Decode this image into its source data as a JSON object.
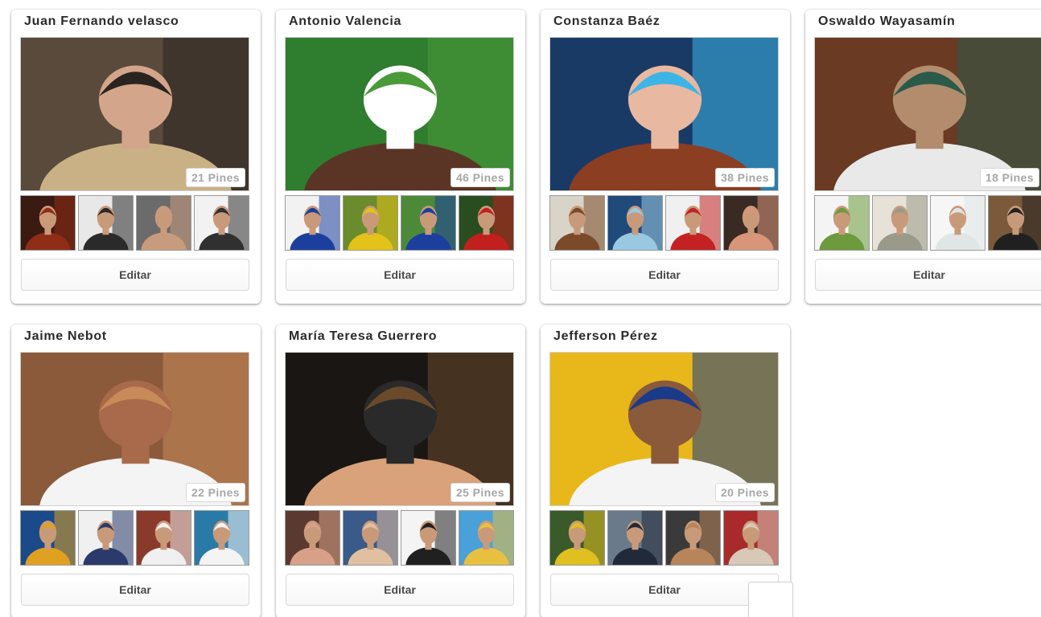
{
  "boards": [
    {
      "title": "Juan Fernando velasco",
      "pins_label": "21 Pines",
      "edit_label": "Editar",
      "cover_colors": [
        "#5a4a3c",
        "#2a2421",
        "#c9b185",
        "#d3a58a"
      ],
      "thumb_colors": [
        [
          "#3b1a12",
          "#8f2d16"
        ],
        [
          "#e8e8e8",
          "#2a2a2a"
        ],
        [
          "#6b6b6b",
          "#c99b7e"
        ],
        [
          "#f2f2f2",
          "#303030"
        ]
      ]
    },
    {
      "title": "Antonio Valencia",
      "pins_label": "46 Pines",
      "edit_label": "Editar",
      "cover_colors": [
        "#2f7d2e",
        "#4a9a3a",
        "#5a3526",
        "#ffffff"
      ],
      "thumb_colors": [
        [
          "#f2f2f2",
          "#1c3f9e"
        ],
        [
          "#6b8c2c",
          "#e3c21a"
        ],
        [
          "#4c8a3a",
          "#1c3f9e"
        ],
        [
          "#2a4d20",
          "#c21f1f"
        ]
      ]
    },
    {
      "title": "Constanza Baéz",
      "pins_label": "38 Pines",
      "edit_label": "Editar",
      "cover_colors": [
        "#1a3a66",
        "#3cb5e6",
        "#8b3e22",
        "#e8b8a0"
      ],
      "thumb_colors": [
        [
          "#d9d4c8",
          "#7a4a2a"
        ],
        [
          "#1f4a7a",
          "#9ac8e0"
        ],
        [
          "#f0f0f0",
          "#c42222"
        ],
        [
          "#3a2a24",
          "#d8957a"
        ]
      ]
    },
    {
      "title": "Oswaldo Wayasamín",
      "pins_label": "18 Pines",
      "edit_label": "Editar",
      "cover_colors": [
        "#6a3a22",
        "#2a5a4a",
        "#e9e9e9",
        "#b28c6c"
      ],
      "thumb_colors": [
        [
          "#f4f4f4",
          "#6c9a3c"
        ],
        [
          "#e6e2d8",
          "#9a9a8a"
        ],
        [
          "#f6f6f6",
          "#e0e6e6"
        ],
        [
          "#7a5a3a",
          "#202020"
        ]
      ]
    },
    {
      "title": "Jaime Nebot",
      "pins_label": "22 Pines",
      "edit_label": "Editar",
      "cover_colors": [
        "#8a5a3a",
        "#c98a5a",
        "#f4f4f4",
        "#a86a4a"
      ],
      "thumb_colors": [
        [
          "#1a4a8a",
          "#e0a020"
        ],
        [
          "#f0f0f0",
          "#2a3a6a"
        ],
        [
          "#8a3a2a",
          "#f0f0f0"
        ],
        [
          "#2a7aa8",
          "#f4f4f4"
        ]
      ]
    },
    {
      "title": "María Teresa Guerrero",
      "pins_label": "25 Pines",
      "edit_label": "Editar",
      "cover_colors": [
        "#1a1614",
        "#6a4a2a",
        "#d9a27a",
        "#2a2a2a"
      ],
      "thumb_colors": [
        [
          "#5a3a30",
          "#d8a088"
        ],
        [
          "#3a5a8a",
          "#e0c0a0"
        ],
        [
          "#f4f4f4",
          "#202020"
        ],
        [
          "#4aa0d8",
          "#e8c040"
        ]
      ]
    },
    {
      "title": "Jefferson Pérez",
      "pins_label": "20 Pines",
      "edit_label": "Editar",
      "cover_colors": [
        "#e8b81a",
        "#1a3a8a",
        "#f4f4f4",
        "#8a5a3a"
      ],
      "thumb_colors": [
        [
          "#3a5a2a",
          "#e0c020"
        ],
        [
          "#6a7a8a",
          "#202a3a"
        ],
        [
          "#3a3a3a",
          "#b8845a"
        ],
        [
          "#a82a2a",
          "#d8c8b8"
        ]
      ]
    }
  ]
}
